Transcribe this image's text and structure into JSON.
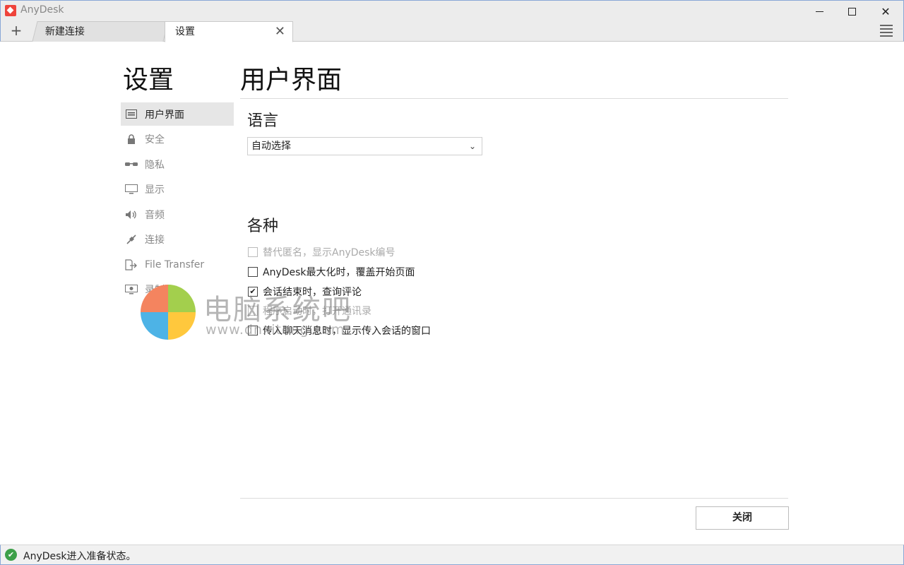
{
  "window": {
    "title": "AnyDesk"
  },
  "tabs": [
    {
      "label": "新建连接"
    },
    {
      "label": "设置"
    }
  ],
  "page": {
    "title": "设置",
    "section_title": "用户界面"
  },
  "sidebar": {
    "items": [
      {
        "label": "用户界面",
        "icon": "interface-icon",
        "active": true
      },
      {
        "label": "安全",
        "icon": "lock-icon"
      },
      {
        "label": "隐私",
        "icon": "glasses-icon"
      },
      {
        "label": "显示",
        "icon": "monitor-icon"
      },
      {
        "label": "音频",
        "icon": "speaker-icon"
      },
      {
        "label": "连接",
        "icon": "plug-icon"
      },
      {
        "label": "File Transfer",
        "icon": "file-transfer-icon"
      },
      {
        "label": "录制",
        "icon": "record-icon"
      }
    ]
  },
  "language": {
    "heading": "语言",
    "selected": "自动选择"
  },
  "misc": {
    "heading": "各种",
    "options": [
      {
        "label": "替代匿名，显示AnyDesk编号",
        "checked": false,
        "disabled": true
      },
      {
        "label": "AnyDesk最大化时，覆盖开始页面",
        "checked": false,
        "disabled": false
      },
      {
        "label": "会话结束时，查询评论",
        "checked": true,
        "disabled": false
      },
      {
        "label": "程序启动时，打开通讯录",
        "checked": false,
        "disabled": true
      },
      {
        "label": "传入聊天消息时，显示传入会话的窗口",
        "checked": false,
        "disabled": false
      }
    ]
  },
  "footer": {
    "close_label": "关闭"
  },
  "watermark": {
    "text": "电脑系统吧",
    "url": "www.dnxitong.com"
  },
  "status": {
    "text": "AnyDesk进入准备状态。"
  }
}
